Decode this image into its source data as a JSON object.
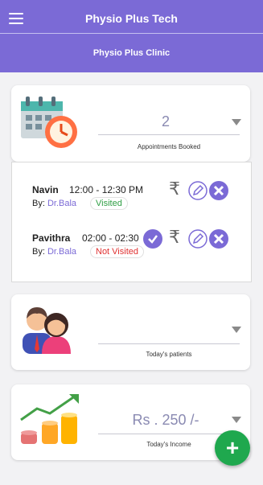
{
  "app": {
    "title": "Physio Plus Tech",
    "subtitle": "Physio Plus Clinic",
    "accent": "#7b6ad6"
  },
  "appointments_card": {
    "value": "2",
    "caption": "Appointments Booked",
    "icon": "calendar-clock-icon"
  },
  "appointments": [
    {
      "name": "Navin",
      "time": "12:00 - 12:30 PM",
      "by_label": "By:",
      "doctor": "Dr.Bala",
      "status": "Visited"
    },
    {
      "name": "Pavithra",
      "time": "02:00 - 02:30",
      "by_label": "By:",
      "doctor": "Dr.Bala",
      "status": "Not Visited"
    }
  ],
  "patients_card": {
    "value": "",
    "caption": "Today's patients",
    "icon": "patients-icon"
  },
  "income_card": {
    "value": "Rs . 250 /-",
    "caption": "Today's Income",
    "icon": "income-growth-icon"
  },
  "fab": {
    "label": "+",
    "color": "#1fa84e"
  },
  "icons": {
    "menu": "hamburger-menu-icon",
    "rupee": "₹",
    "edit": "pencil-icon",
    "cancel": "close-icon",
    "mark_visited": "check-icon",
    "dropdown": "caret-down-icon"
  }
}
